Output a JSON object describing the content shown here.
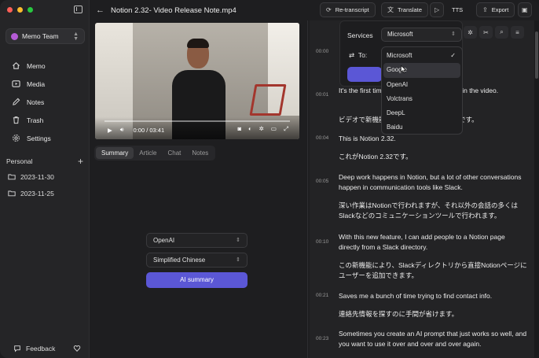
{
  "sidebar": {
    "team": "Memo Team",
    "nav": [
      {
        "label": "Memo",
        "icon": "home-icon"
      },
      {
        "label": "Media",
        "icon": "play-square-icon"
      },
      {
        "label": "Notes",
        "icon": "pen-icon"
      },
      {
        "label": "Trash",
        "icon": "trash-icon"
      },
      {
        "label": "Settings",
        "icon": "gear-icon"
      }
    ],
    "section_title": "Personal",
    "folders": [
      "2023-11-30",
      "2023-11-25"
    ],
    "feedback": "Feedback"
  },
  "toolbar": {
    "title": "Notion 2.32- Video Release Note.mp4",
    "retranscript": "Re-transcript",
    "translate": "Translate",
    "tts": "TTS",
    "export": "Export"
  },
  "player": {
    "time": "0:00 / 03:41",
    "progress": 0
  },
  "tabs": [
    "Summary",
    "Article",
    "Chat",
    "Notes"
  ],
  "summary_panel": {
    "model": "OpenAI",
    "language": "Simplified Chinese",
    "button": "AI summary"
  },
  "services_popover": {
    "services_label": "Services",
    "selected_service": "Microsoft",
    "to_label": "To:",
    "options": [
      "Microsoft",
      "Google",
      "OpenAI",
      "Volctrans",
      "DeepL",
      "Baidu"
    ],
    "hovered_option": "Google"
  },
  "transcript": [
    {
      "time": "00:00",
      "en": "",
      "ja": ""
    },
    {
      "time": "00:01",
      "en": "It's the first time we've seen new features in the video.",
      "ja": "ビデオで新機能を見るのは今回が初めてです。"
    },
    {
      "time": "00:04",
      "en": "This is Notion 2.32.",
      "ja": "これがNotion 2.32です。"
    },
    {
      "time": "00:05",
      "en": "Deep work happens in Notion, but a lot of other conversations happen in communication tools like Slack.",
      "ja": "深い作業はNotionで行われますが、それ以外の会話の多くはSlackなどのコミュニケーションツールで行われます。"
    },
    {
      "time": "00:10",
      "en": "With this new feature, I can add people to a Notion page directly from a Slack directory.",
      "ja": "この新機能により、Slackディレクトリから直接Notionページにユーザーを追加できます。"
    },
    {
      "time": "00:21",
      "en": "Saves me a bunch of time trying to find contact info.",
      "ja": "連絡先情報を探すのに手間が省けます。"
    },
    {
      "time": "00:23",
      "en": "Sometimes you create an AI prompt that just works so well, and you want to use it over and over and over again.",
      "ja": ""
    }
  ]
}
